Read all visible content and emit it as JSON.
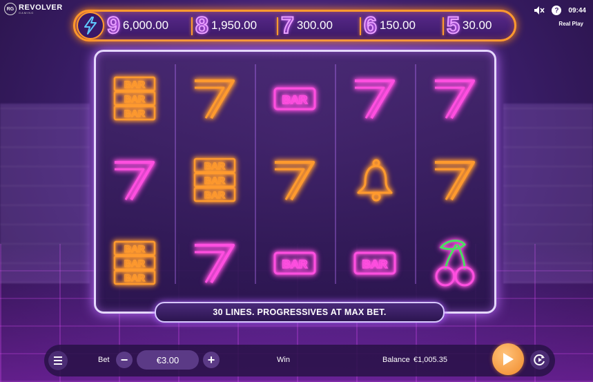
{
  "brand": {
    "logo_badge": "RG",
    "name": "REVOLVER",
    "subtitle": "GAMING"
  },
  "status": {
    "clock": "09:44",
    "mode": "Real Play",
    "help_glyph": "?"
  },
  "progressives": [
    {
      "digit": "9",
      "value": "6,000.00"
    },
    {
      "digit": "8",
      "value": "1,950.00"
    },
    {
      "digit": "7",
      "value": "300.00"
    },
    {
      "digit": "6",
      "value": "150.00"
    },
    {
      "digit": "5",
      "value": "30.00"
    }
  ],
  "reels": {
    "symbols": [
      [
        "triple-bar-orange",
        "seven-pink",
        "triple-bar-orange"
      ],
      [
        "seven-orange",
        "triple-bar-orange",
        "seven-pink"
      ],
      [
        "bar-pink",
        "seven-orange",
        "bar-pink"
      ],
      [
        "seven-pink",
        "bell-orange",
        "bar-pink"
      ],
      [
        "seven-pink",
        "seven-orange",
        "cherries"
      ]
    ],
    "bar_text": "BAR"
  },
  "message": "30 LINES. PROGRESSIVES AT MAX BET.",
  "controls": {
    "bet_label": "Bet",
    "bet_value": "€3.00",
    "minus": "−",
    "plus": "+",
    "win_label": "Win",
    "balance_label": "Balance",
    "balance_value": "€1,005.35"
  },
  "colors": {
    "pink_neon": "#ff4fe0",
    "orange_neon": "#ff9a2e",
    "frame": "#e5d8ff"
  }
}
